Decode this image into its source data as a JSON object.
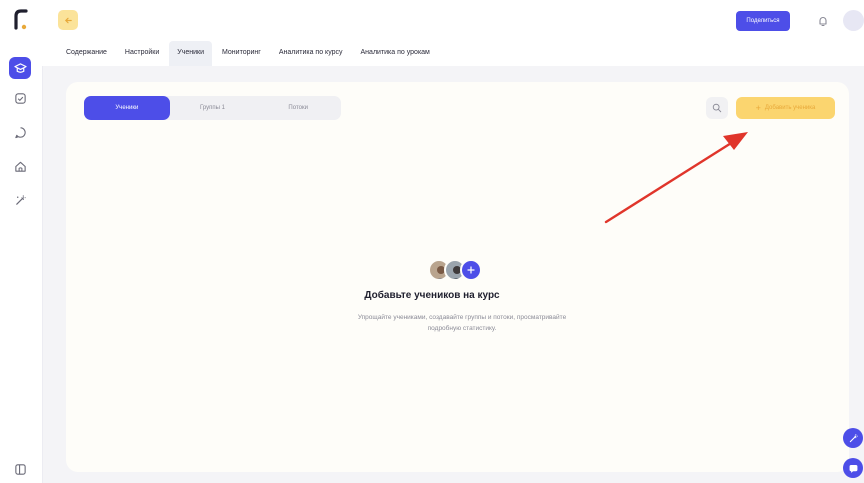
{
  "top": {
    "share_label": "Поделиться"
  },
  "tabs": [
    {
      "label": "Содержание"
    },
    {
      "label": "Настройки"
    },
    {
      "label": "Ученики"
    },
    {
      "label": "Мониторинг"
    },
    {
      "label": "Аналитика по курсу"
    },
    {
      "label": "Аналитика по урокам"
    }
  ],
  "card": {
    "segments": [
      {
        "label": "Ученики"
      },
      {
        "label": "Группы 1"
      },
      {
        "label": "Потоки"
      }
    ],
    "add_label": "Добавить ученика",
    "empty_title": "Добавьте учеников на курс",
    "empty_desc_line1": "Упрощайте учениками, создавайте группы и потоки, просматривайте",
    "empty_desc_line2": "подробную статистику."
  },
  "colors": {
    "accent": "#4d4ee8",
    "yellow": "#fbd56f",
    "arrow": "#e0352b"
  },
  "icons": {
    "sidebar": [
      "course-icon",
      "checklist-icon",
      "chat-icon",
      "home-icon",
      "magic-wand-icon",
      "panel-icon"
    ],
    "top": [
      "arrow-left-icon",
      "bell-icon"
    ],
    "fab": [
      "magic-wand-icon",
      "chat-icon"
    ]
  }
}
